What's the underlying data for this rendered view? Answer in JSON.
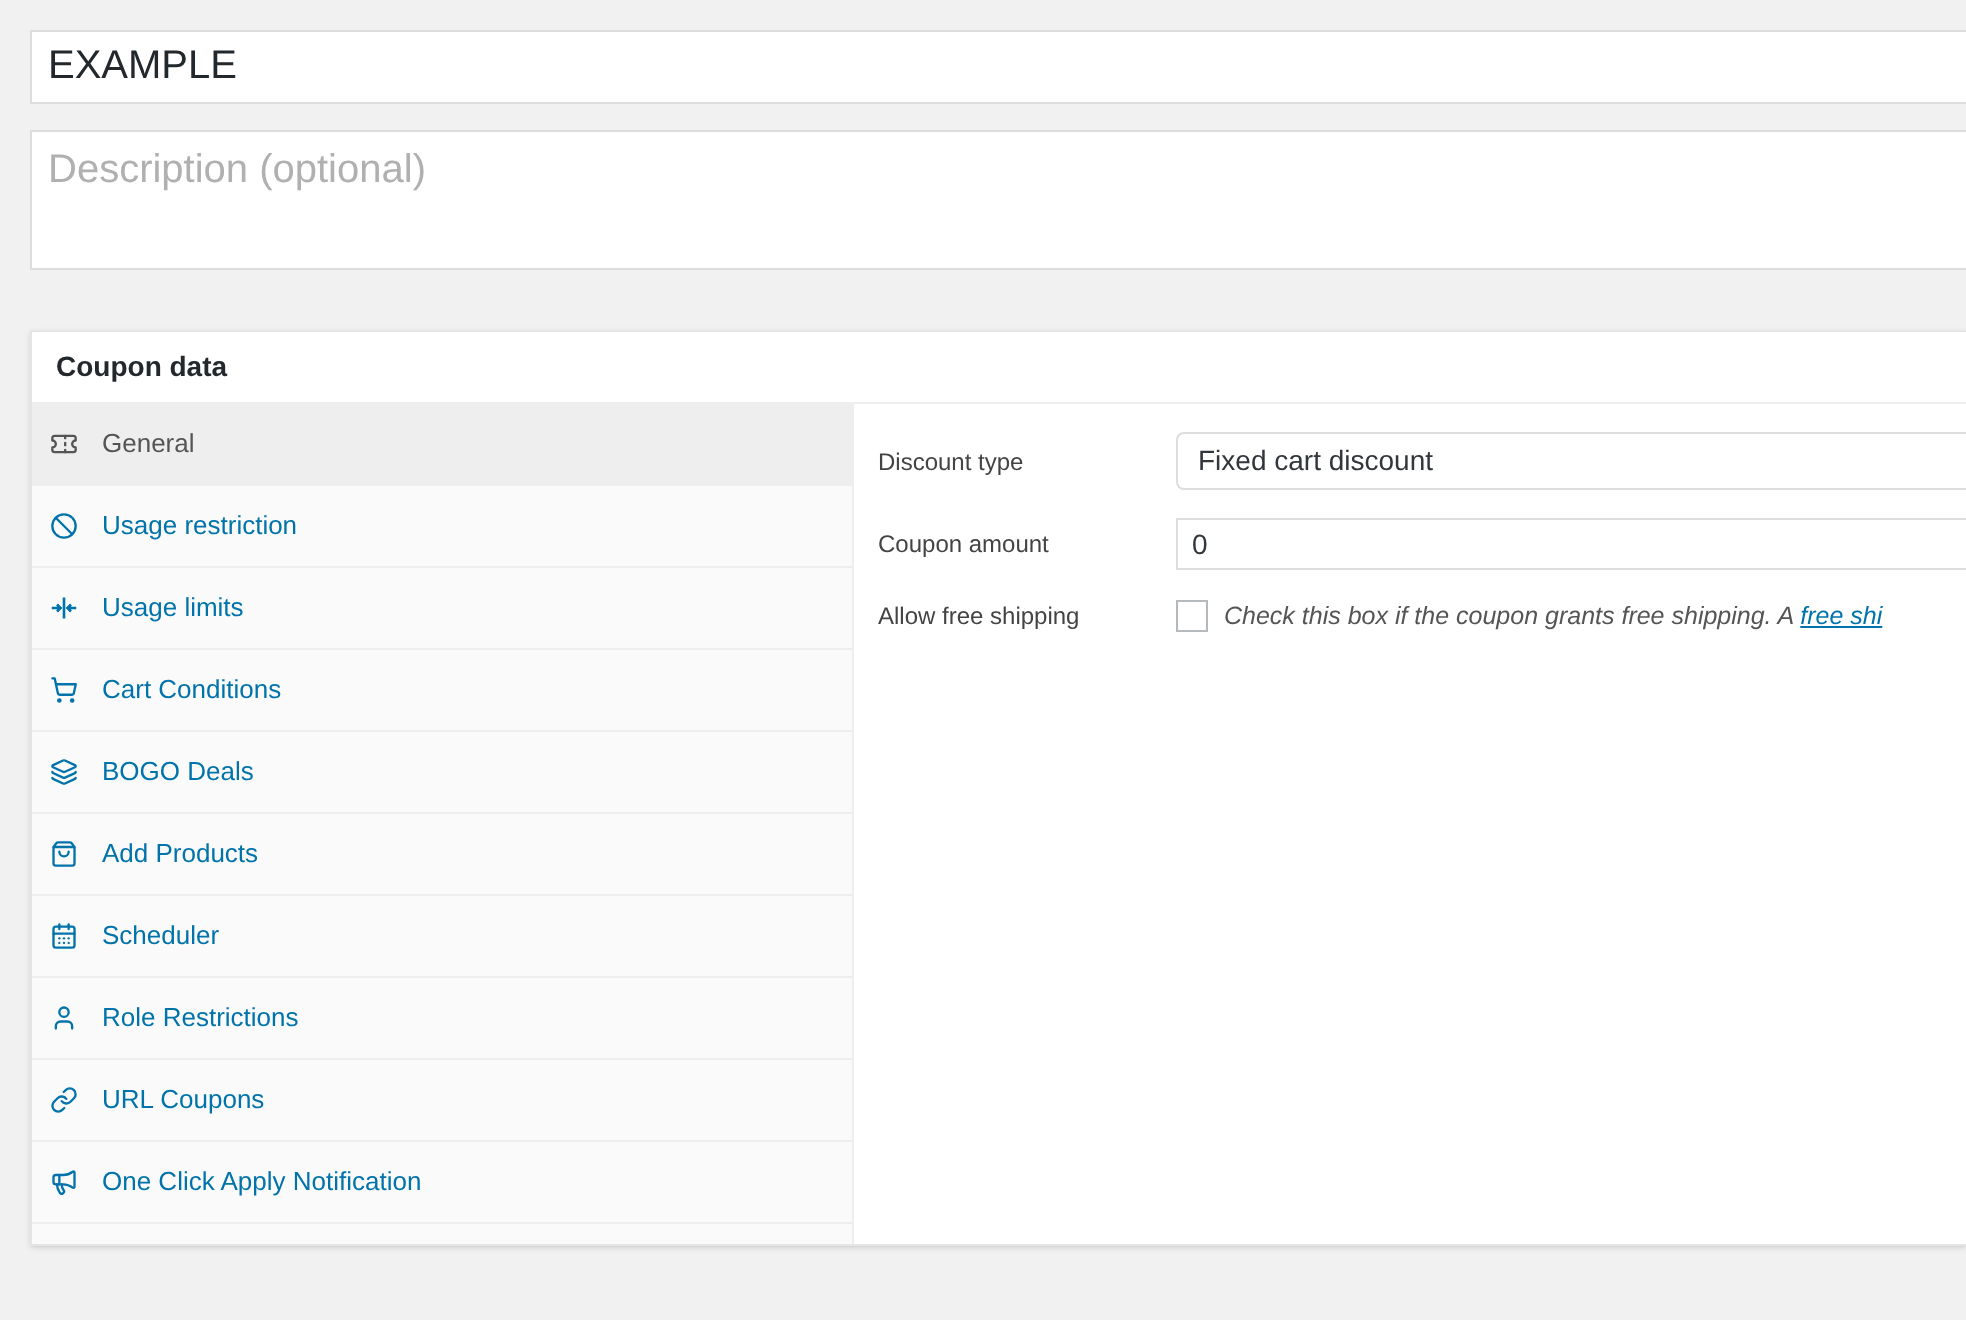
{
  "title_field": {
    "value": "EXAMPLE"
  },
  "description_field": {
    "placeholder": "Description (optional)"
  },
  "panel": {
    "title": "Coupon data",
    "tabs": [
      {
        "label": "General",
        "selected": true
      },
      {
        "label": "Usage restriction",
        "selected": false
      },
      {
        "label": "Usage limits",
        "selected": false
      },
      {
        "label": "Cart Conditions",
        "selected": false
      },
      {
        "label": "BOGO Deals",
        "selected": false
      },
      {
        "label": "Add Products",
        "selected": false
      },
      {
        "label": "Scheduler",
        "selected": false
      },
      {
        "label": "Role Restrictions",
        "selected": false
      },
      {
        "label": "URL Coupons",
        "selected": false
      },
      {
        "label": "One Click Apply Notification",
        "selected": false
      }
    ],
    "fields": [
      {
        "kind": "select",
        "label": "Discount type",
        "value": "Fixed cart discount"
      },
      {
        "kind": "text",
        "label": "Coupon amount",
        "value": "0"
      },
      {
        "kind": "checkbox",
        "label": "Allow free shipping",
        "checked": false,
        "description": "Check this box if the coupon grants free shipping. A ",
        "link": "free shi"
      }
    ]
  }
}
